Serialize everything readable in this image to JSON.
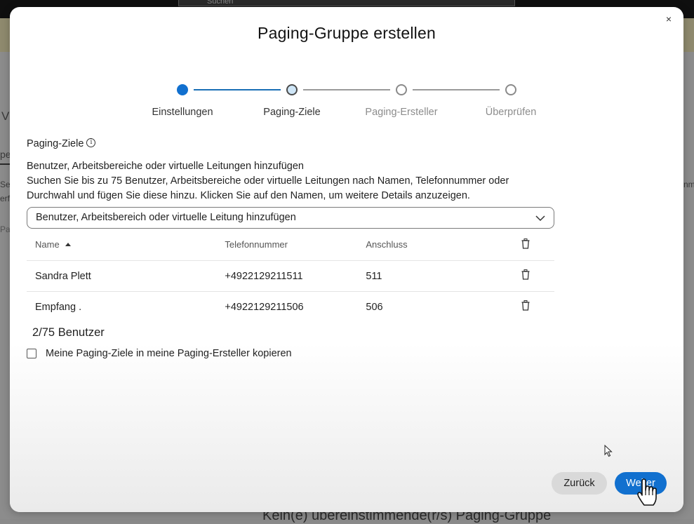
{
  "background": {
    "search_placeholder": "Suchen",
    "bottom_text": "Kein(e) übereinstimmende(r/s) Paging-Gruppe",
    "fragments": [
      "Vi",
      "pe",
      "Se",
      "erf",
      "Pa",
      "nm"
    ]
  },
  "modal": {
    "title": "Paging-Gruppe erstellen",
    "close_glyph": "×",
    "steps": [
      {
        "label": "Einstellungen",
        "state": "completed"
      },
      {
        "label": "Paging-Ziele",
        "state": "current"
      },
      {
        "label": "Paging-Ersteller",
        "state": "upcoming"
      },
      {
        "label": "Überprüfen",
        "state": "upcoming"
      }
    ],
    "section_label": "Paging-Ziele",
    "info_glyph": "i",
    "description": [
      "Benutzer, Arbeitsbereiche oder virtuelle Leitungen hinzufügen",
      "Suchen Sie bis zu 75 Benutzer, Arbeitsbereiche oder virtuelle Leitungen nach Namen, Telefonnummer oder",
      "Durchwahl und fügen Sie diese hinzu. Klicken Sie auf den Namen, um weitere Details anzuzeigen."
    ],
    "select_placeholder": "Benutzer, Arbeitsbereich oder virtuelle Leitung hinzufügen",
    "table": {
      "headers": {
        "name": "Name",
        "phone": "Telefonnummer",
        "extension": "Anschluss"
      },
      "rows": [
        {
          "name": "Sandra Plett",
          "phone": "+4922129211511",
          "extension": "511"
        },
        {
          "name": "Empfang .",
          "phone": "+4922129211506",
          "extension": "506"
        }
      ]
    },
    "count": "2/75 Benutzer",
    "copy_checkbox_label": "Meine Paging-Ziele in meine Paging-Ersteller kopieren",
    "copy_checkbox_checked": false,
    "buttons": {
      "back": "Zurück",
      "next": "Weiter"
    }
  },
  "colors": {
    "accent": "#1170cf",
    "step_current_fill": "#cfe6f7",
    "step_upcoming_border": "#8a8a8a",
    "step_line_done": "#1a6fb5",
    "step_line_todo": "#9a9a9a"
  }
}
